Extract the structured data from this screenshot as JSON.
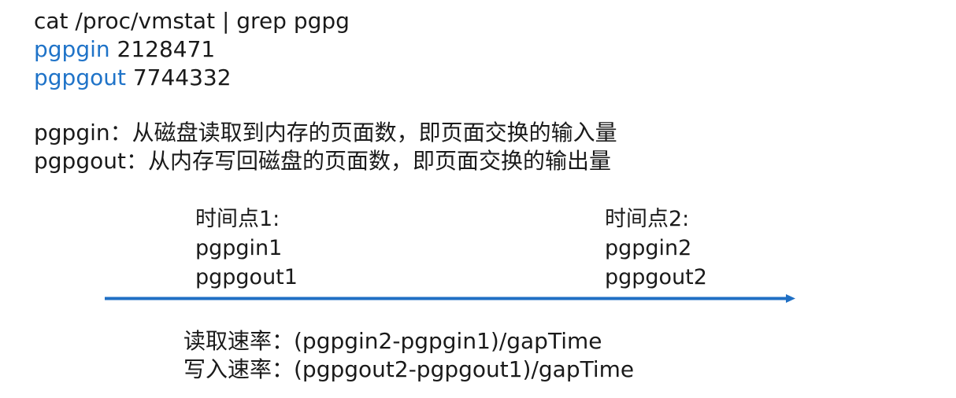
{
  "command": "cat /proc/vmstat | grep pgpg",
  "stats": [
    {
      "key": "pgpgin",
      "value": "2128471"
    },
    {
      "key": "pgpgout",
      "value": "7744332"
    }
  ],
  "definitions": [
    "pgpgin：从磁盘读取到内存的页面数，即页面交换的输入量",
    "pgpgout：从内存写回磁盘的页面数，即页面交换的输出量"
  ],
  "timepoints": [
    {
      "title": "时间点1:",
      "in": "pgpgin1",
      "out": "pgpgout1"
    },
    {
      "title": "时间点2:",
      "in": "pgpgin2",
      "out": "pgpgout2"
    }
  ],
  "formulas": [
    "读取速率：(pgpgin2-pgpgin1)/gapTime",
    "写入速率：(pgpgout2-pgpgout1)/gapTime"
  ],
  "colors": {
    "keyword": "#1f73c8",
    "arrow": "#1f6fc4",
    "text": "#1a1a1a"
  },
  "icons": {
    "timeline": "arrow-right-icon"
  }
}
